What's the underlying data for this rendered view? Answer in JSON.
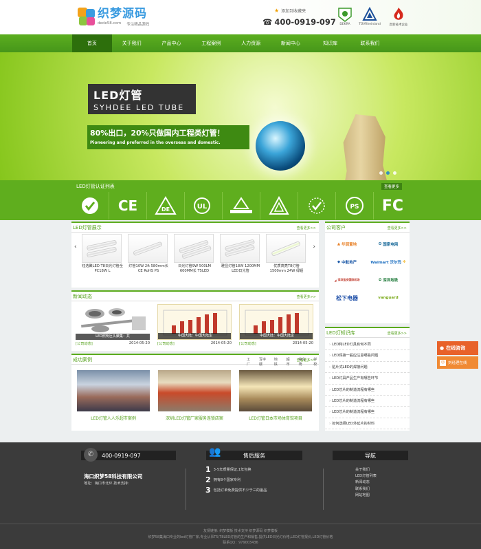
{
  "header": {
    "logo_name": "织梦源码",
    "logo_site": "dede58.com",
    "logo_tagline": "专注精品源码",
    "favorite": "添加到收藏夹",
    "phone": "400-0919-097",
    "certs": [
      "DEKRA",
      "TÜVRheinland",
      "高新技术企业"
    ]
  },
  "nav": {
    "items": [
      "首页",
      "关于我们",
      "产品中心",
      "工程案例",
      "人力资源",
      "新闻中心",
      "知识库",
      "联系我们"
    ]
  },
  "banner": {
    "title": "LED灯管",
    "subtitle": "SYHDEE LED TUBE",
    "slogan": "80%出口，20%只做国内工程类灯管！",
    "slogan_en": "Pioneering and preferred in the overseas and domestic."
  },
  "certbar": {
    "title": "LED灯管认证列表",
    "more": "查看更多",
    "logos": [
      "C",
      "CE",
      "DE",
      "UL",
      "TÜV",
      "△",
      "✓",
      "PSE",
      "FC"
    ]
  },
  "products": {
    "title": "LED灯管展示",
    "more": "查看更多>>",
    "items": [
      {
        "name": "钰浩聚LED T8日光灯管全PC18W L"
      },
      {
        "name": "灯管10W 2ft 580mm长 CE RoHS PS"
      },
      {
        "name": "日光灯管9W 500LM 600MM长 T5LED"
      },
      {
        "name": "雅显灯管18W 1200MM LED日光管"
      },
      {
        "name": "优质高亮T8灯管 1500mm 24W 绿铝"
      }
    ]
  },
  "news": {
    "title": "新闻动态",
    "more": "查看更多>>",
    "items": [
      {
        "caption": "LED照明巨头聚集：共",
        "category": "[公司动态]",
        "date": "2014-05-20"
      },
      {
        "caption": "中国大陆：中国大陆企",
        "category": "[公司动态]",
        "date": "2014-05-20"
      },
      {
        "caption": "中国大陆：中国大陆企",
        "category": "[公司动态]",
        "date": "2014-05-20"
      }
    ]
  },
  "cases": {
    "title": "成功案例",
    "more": "查看更多>>",
    "tabs": [
      "工厂",
      "写字楼",
      "地铁",
      "超市",
      "停车场",
      "学校"
    ],
    "items": [
      {
        "caption": "LED灯管人人乐超市案例"
      },
      {
        "caption": "深圳LED灯管厂家服务连锁店案"
      },
      {
        "caption": "LED灯管日本市场体育馆项目"
      }
    ]
  },
  "clients": {
    "title": "公司客户",
    "more": "查看更多>>",
    "items": [
      "华润置地",
      "国家电网",
      "中航地产",
      "Walmart 沃尔玛",
      "深圳宝安国际机场",
      "深圳地铁",
      "松下电器",
      "vanguard"
    ]
  },
  "knowledge": {
    "title": "LED灯知识库",
    "more": "查看更多>>",
    "items": [
      "LED和LED灯具有何不同",
      "LED焊接一般应注意哪些问题",
      "贴片式LED的焊接问题",
      "LED灯具产品生产有哪些环节",
      "LED芯片的制造流程有哪些",
      "LED芯片的制造流程有哪些",
      "LED芯片的制造流程有哪些",
      "如何选择LED外延片的材料"
    ]
  },
  "float": {
    "consult": "在线咨询",
    "online": "刘经理在线"
  },
  "footer": {
    "phone": "400-0919-097",
    "company": "海口织梦58科技有限公司",
    "address": "地址：海口市北环 技术支持:",
    "service_title": "售后服务",
    "service": [
      {
        "num": "1",
        "text": "3-5年质量保证,1年包换"
      },
      {
        "num": "2",
        "text": "拥有8个国家专利"
      },
      {
        "num": "3",
        "text": "包括订单免费提供不少于三的备品"
      }
    ],
    "nav_title": "导航",
    "nav_links": [
      "关于我们",
      "LED灯管列表",
      "新闻动态",
      "联系我们",
      "网站地图"
    ],
    "links": "友情链接: 织梦模板 技术支持 织梦源码 织梦模板",
    "copyright": "织梦58集海口专业的led灯管厂家,专业从事T5/T8LED灯管的生产和销售,提供LED日光灯价格,LED灯管报价,LED灯管价格",
    "qq": "联系QQ：979003436"
  }
}
